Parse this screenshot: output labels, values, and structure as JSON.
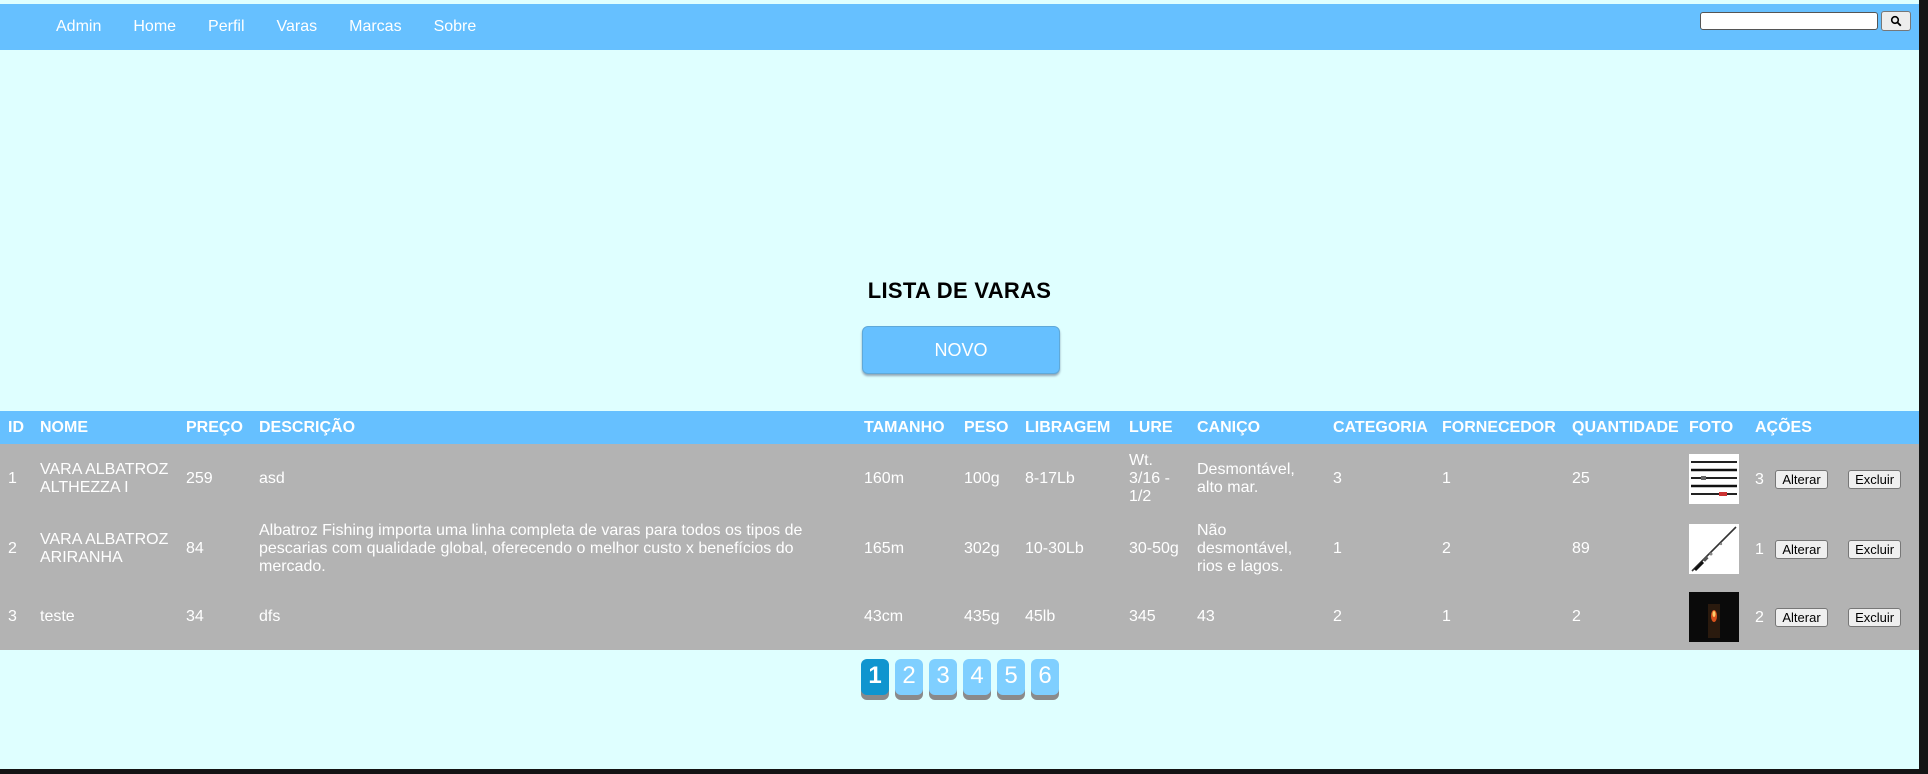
{
  "nav": {
    "links": [
      "Admin",
      "Home",
      "Perfil",
      "Varas",
      "Marcas",
      "Sobre"
    ],
    "search": {
      "value": "",
      "button_icon": "search-icon"
    }
  },
  "page": {
    "title": "LISTA DE VARAS",
    "new_button": "NOVO"
  },
  "table": {
    "headers": [
      "ID",
      "NOME",
      "PREÇO",
      "DESCRIÇÃO",
      "TAMANHO",
      "PESO",
      "LIBRAGEM",
      "LURE",
      "CANIÇO",
      "CATEGORIA",
      "FORNECEDOR",
      "QUANTIDADE",
      "FOTO",
      "AÇÕES"
    ],
    "rows": [
      {
        "id": "1",
        "nome": "VARA ALBATROZ ALTHEZZA I",
        "preco": "259",
        "descricao": "asd",
        "tamanho": "160m",
        "peso": "100g",
        "libragem": "8-17Lb",
        "lure": "Wt. 3/16 - 1/2",
        "canico": "Desmontável, alto mar.",
        "categoria": "3",
        "fornecedor": "1",
        "quantidade": "25",
        "foto": "rod-sections-photo",
        "acao_num": "3",
        "alterar": "Alterar",
        "excluir": "Excluir"
      },
      {
        "id": "2",
        "nome": "VARA ALBATROZ ARIRANHA",
        "preco": "84",
        "descricao": "Albatroz Fishing importa uma linha completa de varas para todos os tipos de pescarias com qualidade global, oferecendo o melhor custo x benefícios do mercado.",
        "tamanho": "165m",
        "peso": "302g",
        "libragem": "10-30Lb",
        "lure": "30-50g",
        "canico": "Não desmontável, rios e lagos.",
        "categoria": "1",
        "fornecedor": "2",
        "quantidade": "89",
        "foto": "single-rod-photo",
        "acao_num": "1",
        "alterar": "Alterar",
        "excluir": "Excluir"
      },
      {
        "id": "3",
        "nome": "teste",
        "preco": "34",
        "descricao": "dfs",
        "tamanho": "43cm",
        "peso": "435g",
        "libragem": "45lb",
        "lure": "345",
        "canico": "43",
        "categoria": "2",
        "fornecedor": "1",
        "quantidade": "2",
        "foto": "dark-candle-photo",
        "acao_num": "2",
        "alterar": "Alterar",
        "excluir": "Excluir"
      }
    ]
  },
  "pagination": {
    "pages": [
      "1",
      "2",
      "3",
      "4",
      "5",
      "6"
    ],
    "current": "1"
  },
  "colors": {
    "header_blue": "#66c0ff",
    "page_bg": "#dfffff",
    "row_gray": "#b3b3b3",
    "active_page": "#0f95cf"
  }
}
